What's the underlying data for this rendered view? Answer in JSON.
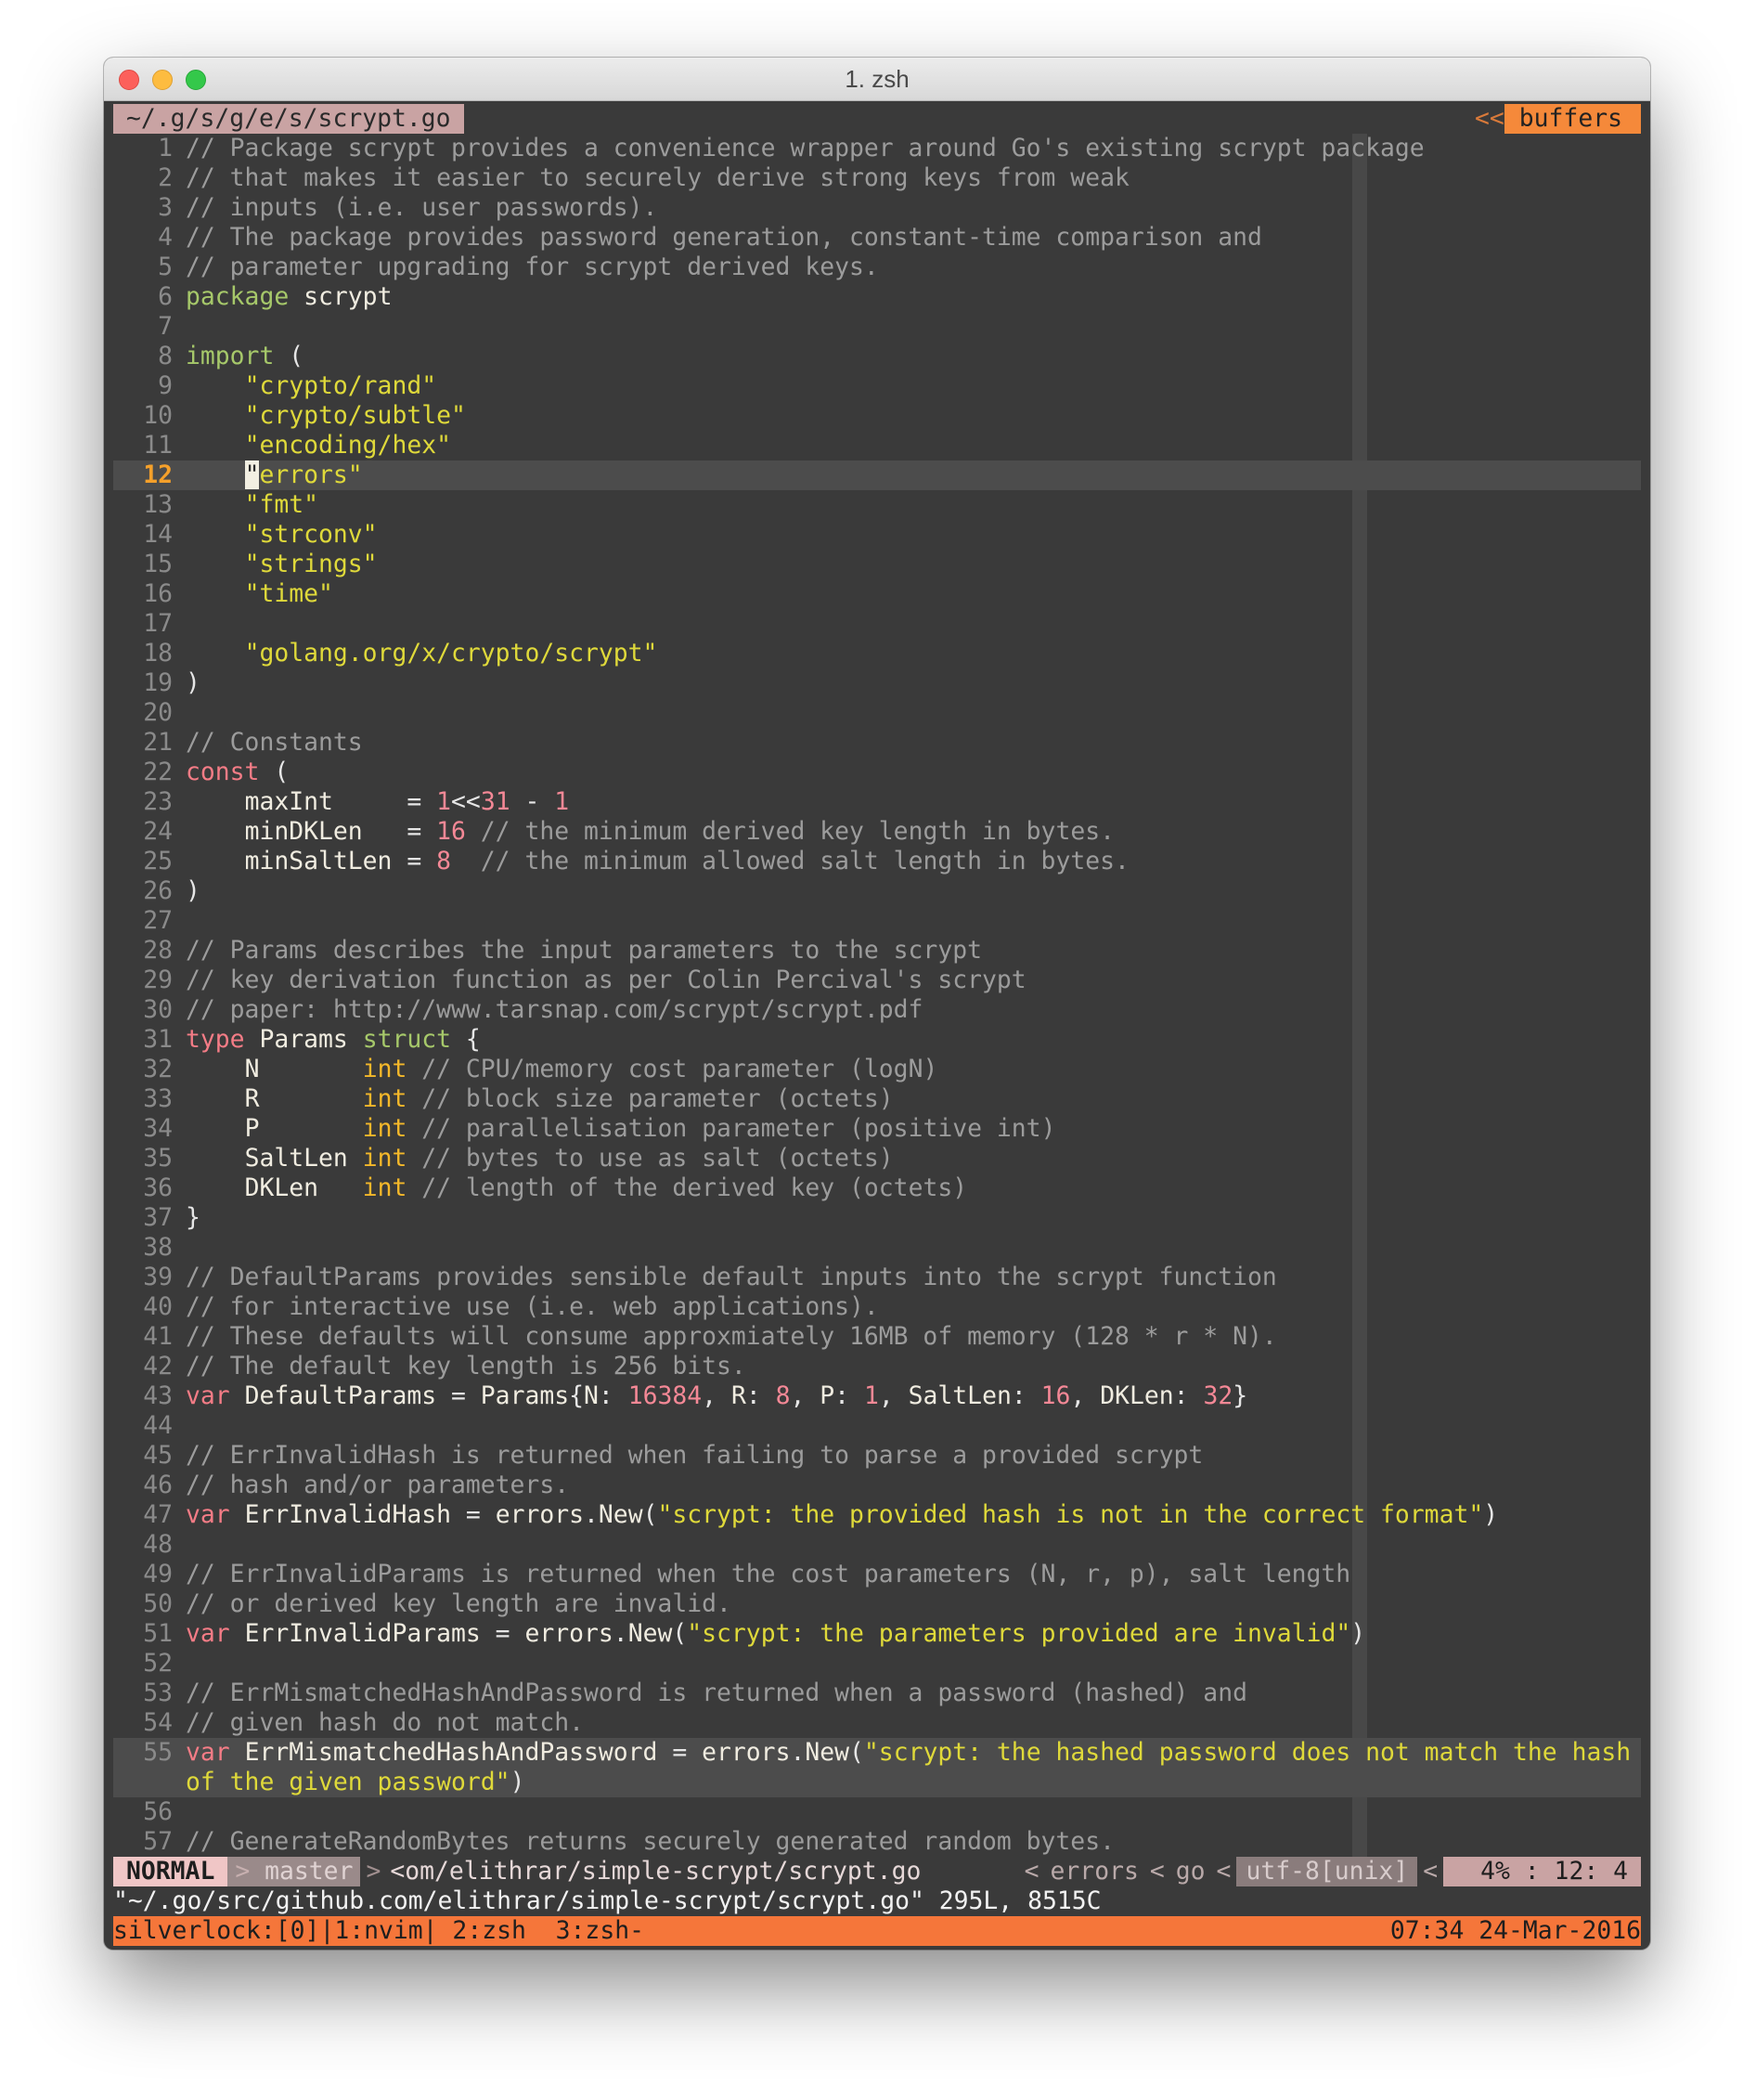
{
  "window": {
    "title": "1. zsh"
  },
  "tabline": {
    "buffer_name": "~/.g/s/g/e/s/scrypt.go",
    "arrow": "<<",
    "buffers_label": "buffers"
  },
  "code_lines": [
    {
      "n": "1",
      "t": "// Package scrypt provides a convenience wrapper around Go's existing scrypt package"
    },
    {
      "n": "2",
      "t": "// that makes it easier to securely derive strong keys from weak"
    },
    {
      "n": "3",
      "t": "// inputs (i.e. user passwords)."
    },
    {
      "n": "4",
      "t": "// The package provides password generation, constant-time comparison and"
    },
    {
      "n": "5",
      "t": "// parameter upgrading for scrypt derived keys."
    },
    {
      "n": "6",
      "t": "package scrypt"
    },
    {
      "n": "7",
      "t": ""
    },
    {
      "n": "8",
      "t": "import ("
    },
    {
      "n": "9",
      "t": "    \"crypto/rand\""
    },
    {
      "n": "10",
      "t": "    \"crypto/subtle\""
    },
    {
      "n": "11",
      "t": "    \"encoding/hex\""
    },
    {
      "n": "12",
      "t": "    \"errors\""
    },
    {
      "n": "13",
      "t": "    \"fmt\""
    },
    {
      "n": "14",
      "t": "    \"strconv\""
    },
    {
      "n": "15",
      "t": "    \"strings\""
    },
    {
      "n": "16",
      "t": "    \"time\""
    },
    {
      "n": "17",
      "t": ""
    },
    {
      "n": "18",
      "t": "    \"golang.org/x/crypto/scrypt\""
    },
    {
      "n": "19",
      "t": ")"
    },
    {
      "n": "20",
      "t": ""
    },
    {
      "n": "21",
      "t": "// Constants"
    },
    {
      "n": "22",
      "t": "const ("
    },
    {
      "n": "23",
      "t": "    maxInt     = 1<<31 - 1"
    },
    {
      "n": "24",
      "t": "    minDKLen   = 16 // the minimum derived key length in bytes."
    },
    {
      "n": "25",
      "t": "    minSaltLen = 8  // the minimum allowed salt length in bytes."
    },
    {
      "n": "26",
      "t": ")"
    },
    {
      "n": "27",
      "t": ""
    },
    {
      "n": "28",
      "t": "// Params describes the input parameters to the scrypt"
    },
    {
      "n": "29",
      "t": "// key derivation function as per Colin Percival's scrypt"
    },
    {
      "n": "30",
      "t": "// paper: http://www.tarsnap.com/scrypt/scrypt.pdf"
    },
    {
      "n": "31",
      "t": "type Params struct {"
    },
    {
      "n": "32",
      "t": "    N       int // CPU/memory cost parameter (logN)"
    },
    {
      "n": "33",
      "t": "    R       int // block size parameter (octets)"
    },
    {
      "n": "34",
      "t": "    P       int // parallelisation parameter (positive int)"
    },
    {
      "n": "35",
      "t": "    SaltLen int // bytes to use as salt (octets)"
    },
    {
      "n": "36",
      "t": "    DKLen   int // length of the derived key (octets)"
    },
    {
      "n": "37",
      "t": "}"
    },
    {
      "n": "38",
      "t": ""
    },
    {
      "n": "39",
      "t": "// DefaultParams provides sensible default inputs into the scrypt function"
    },
    {
      "n": "40",
      "t": "// for interactive use (i.e. web applications)."
    },
    {
      "n": "41",
      "t": "// These defaults will consume approxmiately 16MB of memory (128 * r * N)."
    },
    {
      "n": "42",
      "t": "// The default key length is 256 bits."
    },
    {
      "n": "43",
      "t": "var DefaultParams = Params{N: 16384, R: 8, P: 1, SaltLen: 16, DKLen: 32}"
    },
    {
      "n": "44",
      "t": ""
    },
    {
      "n": "45",
      "t": "// ErrInvalidHash is returned when failing to parse a provided scrypt"
    },
    {
      "n": "46",
      "t": "// hash and/or parameters."
    },
    {
      "n": "47",
      "t": "var ErrInvalidHash = errors.New(\"scrypt: the provided hash is not in the correct format\")"
    },
    {
      "n": "48",
      "t": ""
    },
    {
      "n": "49",
      "t": "// ErrInvalidParams is returned when the cost parameters (N, r, p), salt length"
    },
    {
      "n": "50",
      "t": "// or derived key length are invalid."
    },
    {
      "n": "51",
      "t": "var ErrInvalidParams = errors.New(\"scrypt: the parameters provided are invalid\")"
    },
    {
      "n": "52",
      "t": ""
    },
    {
      "n": "53",
      "t": "// ErrMismatchedHashAndPassword is returned when a password (hashed) and"
    },
    {
      "n": "54",
      "t": "// given hash do not match."
    },
    {
      "n": "55",
      "t": "var ErrMismatchedHashAndPassword = errors.New(\"scrypt: the hashed password does not match the hash"
    },
    {
      "n": "",
      "t": "of the given password\")"
    },
    {
      "n": "56",
      "t": ""
    },
    {
      "n": "57",
      "t": "// GenerateRandomBytes returns securely generated random bytes."
    }
  ],
  "statusline": {
    "mode": "NORMAL",
    "sep1": ">",
    "branch": "master",
    "sep2": ">",
    "path": "<om/elithrar/simple-scrypt/scrypt.go",
    "sep3": "<",
    "errors": "errors",
    "sep4": "<",
    "filetype": "go",
    "sep5": "<",
    "encoding": "utf-8[unix]",
    "sep6": "<",
    "position": "4% :  12:  4"
  },
  "message_line": "\"~/.go/src/github.com/elithrar/simple-scrypt/scrypt.go\" 295L, 8515C",
  "tmux": {
    "left": "silverlock:[0]|1:nvim| 2:zsh  3:zsh-",
    "right": "07:34 24-Mar-2016"
  },
  "colors": {
    "background": "#3a3a3a",
    "comment": "#9c9c9c",
    "keyword": "#a6c86a",
    "keyword_red": "#f47c86",
    "type": "#f4b82a",
    "string": "#dfd93a",
    "number": "#f48896",
    "tmux_bar": "#f5763a",
    "buffers_badge": "#f5893a"
  }
}
